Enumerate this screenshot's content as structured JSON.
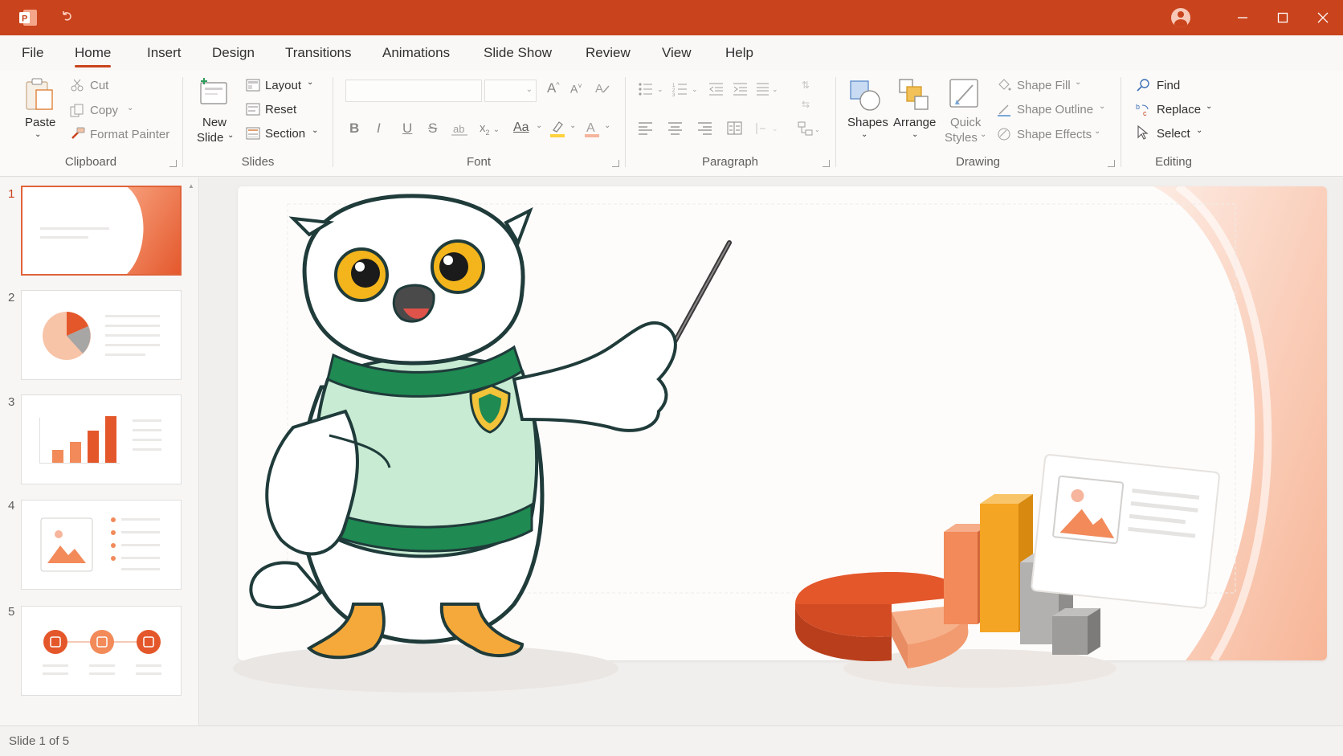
{
  "app": {
    "icon": "powerpoint-icon",
    "accent": "#c9431c"
  },
  "tabs": [
    "File",
    "Home",
    "Insert",
    "Design",
    "Transitions",
    "Animations",
    "Slide Show",
    "Review",
    "View",
    "Help"
  ],
  "active_tab": "Home",
  "ribbon": {
    "clipboard": {
      "label": "Clipboard",
      "paste": "Paste",
      "cut": "Cut",
      "copy": "Copy",
      "format_painter": "Format Painter"
    },
    "slides": {
      "label": "Slides",
      "new_slide_line1": "New",
      "new_slide_line2": "Slide",
      "layout": "Layout",
      "reset": "Reset",
      "section": "Section"
    },
    "font": {
      "label": "Font",
      "bold": "B",
      "italic": "I",
      "underline": "U",
      "strike": "S",
      "change_case": "Aa"
    },
    "paragraph": {
      "label": "Paragraph"
    },
    "drawing": {
      "label": "Drawing",
      "shapes": "Shapes",
      "arrange": "Arrange",
      "quick_line1": "Quick",
      "quick_line2": "Styles",
      "shape_fill": "Shape Fill",
      "shape_outline": "Shape Outline",
      "shape_effects": "Shape Effects"
    },
    "editing": {
      "label": "Editing",
      "find": "Find",
      "replace": "Replace",
      "select": "Select"
    }
  },
  "slides": [
    {
      "number": "1",
      "active": true
    },
    {
      "number": "2",
      "active": false
    },
    {
      "number": "3",
      "active": false
    },
    {
      "number": "4",
      "active": false
    },
    {
      "number": "5",
      "active": false
    }
  ],
  "status": {
    "slide_info": "Slide 1 of 5"
  }
}
